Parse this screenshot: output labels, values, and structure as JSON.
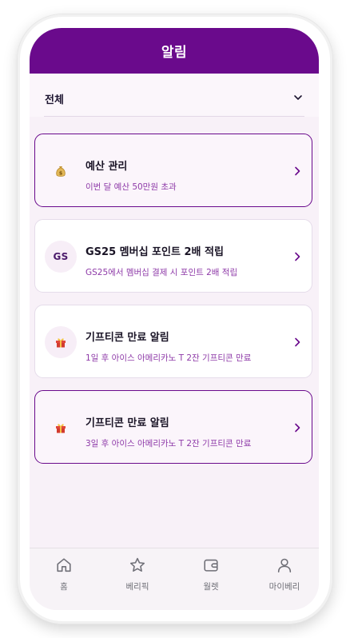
{
  "header": {
    "title": "알림"
  },
  "filter": {
    "selected": "전체"
  },
  "notifications": [
    {
      "icon": "money-bag-icon",
      "title": "예산 관리",
      "desc": "이번 달 예산 50만원 초과",
      "active": true
    },
    {
      "icon": "gs-logo",
      "icon_text": "GS",
      "title": "GS25 멤버십 포인트 2배 적립",
      "desc": "GS25에서 멤버십 결제 시 포인트 2배 적립",
      "active": false
    },
    {
      "icon": "gift-icon",
      "title": "기프티콘 만료 알림",
      "desc": "1일 후 아이스 아메리카노 T 2잔 기프티콘 만료",
      "active": false
    },
    {
      "icon": "gift-icon",
      "title": "기프티콘 만료 알림",
      "desc": "3일 후 아이스 아메리카노 T 2잔 기프티콘 만료",
      "active": true
    }
  ],
  "tabs": [
    {
      "icon": "home-icon",
      "label": "홈"
    },
    {
      "icon": "star-icon",
      "label": "베리픽"
    },
    {
      "icon": "wallet-icon",
      "label": "월렛"
    },
    {
      "icon": "user-icon",
      "label": "마이베리"
    }
  ],
  "colors": {
    "brand": "#6a0a8c",
    "accent_text": "#8e3aa8",
    "background": "#f8f1f8"
  }
}
